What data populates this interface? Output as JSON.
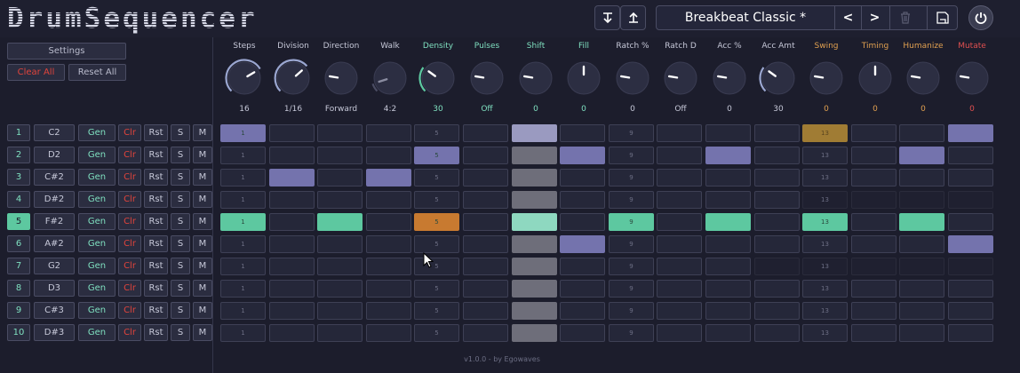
{
  "header": {
    "logo": "DrumSequencer",
    "preset_name": "Breakbeat Classic *",
    "prev_label": "<",
    "next_label": ">",
    "icons": {
      "load": "arrow-down-icon",
      "save_upload": "arrow-up-icon",
      "delete": "trash-icon",
      "save": "floppy-icon",
      "power": "power-icon"
    }
  },
  "left": {
    "settings_label": "Settings",
    "clear_all_label": "Clear All",
    "reset_all_label": "Reset All"
  },
  "row_labels": {
    "gen": "Gen",
    "clr": "Clr",
    "rst": "Rst",
    "solo": "S",
    "mute": "M"
  },
  "tracks": [
    {
      "num": "1",
      "note": "C2",
      "selected": false
    },
    {
      "num": "2",
      "note": "D2",
      "selected": false
    },
    {
      "num": "3",
      "note": "C#2",
      "selected": false
    },
    {
      "num": "4",
      "note": "D#2",
      "selected": false
    },
    {
      "num": "5",
      "note": "F#2",
      "selected": true
    },
    {
      "num": "6",
      "note": "A#2",
      "selected": false
    },
    {
      "num": "7",
      "note": "G2",
      "selected": false
    },
    {
      "num": "8",
      "note": "D3",
      "selected": false
    },
    {
      "num": "9",
      "note": "C#3",
      "selected": false
    },
    {
      "num": "10",
      "note": "D#3",
      "selected": false
    }
  ],
  "params": [
    {
      "label": "Steps",
      "value": "16",
      "color": "#c6c8d8",
      "knob": 0.72,
      "arc": "full"
    },
    {
      "label": "Division",
      "value": "1/16",
      "color": "#c6c8d8",
      "knob": 0.68,
      "arc": "partial"
    },
    {
      "label": "Direction",
      "value": "Forward",
      "color": "#c6c8d8",
      "knob": 0.2,
      "arc": "none"
    },
    {
      "label": "Walk",
      "value": "4:2",
      "color": "#c6c8d8",
      "knob": 0.1,
      "arc": "dim"
    },
    {
      "label": "Density",
      "value": "30",
      "color": "#7fe0c0",
      "knob": 0.3,
      "arc": "teal"
    },
    {
      "label": "Pulses",
      "value": "Off",
      "color": "#7fe0c0",
      "knob": 0.2,
      "arc": "none"
    },
    {
      "label": "Shift",
      "value": "0",
      "color": "#7fe0c0",
      "knob": 0.2,
      "arc": "none"
    },
    {
      "label": "Fill",
      "value": "0",
      "color": "#7fe0c0",
      "knob": 0.5,
      "arc": "none"
    },
    {
      "label": "Ratch %",
      "value": "0",
      "color": "#c6c8d8",
      "knob": 0.2,
      "arc": "none"
    },
    {
      "label": "Ratch D",
      "value": "Off",
      "color": "#c6c8d8",
      "knob": 0.2,
      "arc": "none"
    },
    {
      "label": "Acc %",
      "value": "0",
      "color": "#c6c8d8",
      "knob": 0.2,
      "arc": "none"
    },
    {
      "label": "Acc Amt",
      "value": "30",
      "color": "#c6c8d8",
      "knob": 0.3,
      "arc": "partial"
    },
    {
      "label": "Swing",
      "value": "0",
      "color": "#e0a050",
      "knob": 0.2,
      "arc": "none"
    },
    {
      "label": "Timing",
      "value": "0",
      "color": "#e0a050",
      "knob": 0.5,
      "arc": "none"
    },
    {
      "label": "Humanize",
      "value": "0",
      "color": "#e0a050",
      "knob": 0.2,
      "arc": "none"
    },
    {
      "label": "Mutate",
      "value": "0",
      "color": "#e05050",
      "knob": 0.2,
      "arc": "none"
    }
  ],
  "grid": {
    "bar_labels": [
      {
        "col": 0,
        "text": "1"
      },
      {
        "col": 4,
        "text": "5"
      },
      {
        "col": 8,
        "text": "9"
      },
      {
        "col": 12,
        "text": "13"
      }
    ],
    "colors": {
      "purple": "#7473ad",
      "teal": "#5dc8a0",
      "orange": "#c87a30",
      "gold": "#a07c34",
      "light_purple": "#9a9ac0",
      "mid_gray": "#6e6e7a",
      "light_teal": "#8ed8c0",
      "empty": "#252739",
      "dim": "#1f2030"
    },
    "rows": [
      [
        "purple",
        "empty",
        "empty",
        "empty",
        "empty",
        "empty",
        "light_purple",
        "empty",
        "empty",
        "empty",
        "empty",
        "empty",
        "gold",
        "empty",
        "empty",
        "purple"
      ],
      [
        "empty",
        "empty",
        "empty",
        "empty",
        "purple",
        "empty",
        "mid_gray",
        "purple",
        "empty",
        "empty",
        "purple",
        "empty",
        "empty",
        "empty",
        "purple",
        "empty"
      ],
      [
        "empty",
        "purple",
        "empty",
        "purple",
        "empty",
        "empty",
        "mid_gray",
        "empty",
        "empty",
        "empty",
        "empty",
        "empty",
        "empty",
        "empty",
        "empty",
        "empty"
      ],
      [
        "empty",
        "empty",
        "empty",
        "empty",
        "empty",
        "empty",
        "mid_gray",
        "empty",
        "empty",
        "empty",
        "empty",
        "empty",
        "dim",
        "dim",
        "dim",
        "dim"
      ],
      [
        "teal",
        "empty",
        "teal",
        "empty",
        "orange",
        "empty",
        "light_teal",
        "empty",
        "teal",
        "empty",
        "teal",
        "empty",
        "teal",
        "empty",
        "teal",
        "empty"
      ],
      [
        "empty",
        "empty",
        "empty",
        "empty",
        "empty",
        "empty",
        "mid_gray",
        "purple",
        "empty",
        "empty",
        "empty",
        "empty",
        "empty",
        "empty",
        "empty",
        "purple"
      ],
      [
        "empty",
        "empty",
        "empty",
        "empty",
        "empty",
        "empty",
        "mid_gray",
        "empty",
        "empty",
        "empty",
        "empty",
        "dim",
        "dim",
        "dim",
        "dim",
        "dim"
      ],
      [
        "empty",
        "empty",
        "empty",
        "empty",
        "empty",
        "empty",
        "mid_gray",
        "empty",
        "empty",
        "empty",
        "empty",
        "empty",
        "empty",
        "empty",
        "empty",
        "empty"
      ],
      [
        "empty",
        "empty",
        "empty",
        "empty",
        "empty",
        "empty",
        "mid_gray",
        "empty",
        "empty",
        "empty",
        "empty",
        "empty",
        "empty",
        "empty",
        "empty",
        "empty"
      ],
      [
        "empty",
        "empty",
        "empty",
        "empty",
        "empty",
        "empty",
        "mid_gray",
        "empty",
        "empty",
        "empty",
        "empty",
        "empty",
        "empty",
        "empty",
        "empty",
        "empty"
      ]
    ]
  },
  "footer": "v1.0.0 - by Egowaves"
}
